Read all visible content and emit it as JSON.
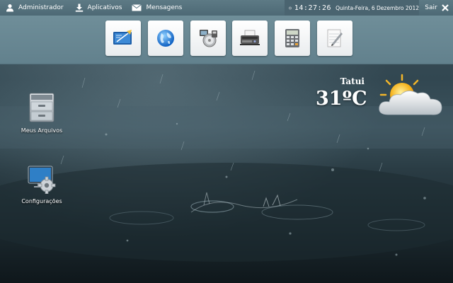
{
  "topbar": {
    "user_label": "Administrador",
    "apps_label": "Aplicativos",
    "messages_label": "Mensagens",
    "clock_time": "14:27:26",
    "clock_date": "Quinta-Feira, 6 Dezembro 2012",
    "exit_label": "Sair"
  },
  "dock": {
    "items": [
      {
        "icon": "text-editor-icon"
      },
      {
        "icon": "globe-browser-icon"
      },
      {
        "icon": "media-player-icon"
      },
      {
        "icon": "fax-printer-icon"
      },
      {
        "icon": "calculator-icon"
      },
      {
        "icon": "notepad-icon"
      }
    ]
  },
  "desktop": {
    "icons": [
      {
        "label": "Meus Arquivos",
        "icon": "file-cabinet-icon"
      },
      {
        "label": "Configurações",
        "icon": "settings-monitor-icon"
      }
    ]
  },
  "weather": {
    "city": "Tatui",
    "temperature": "31ºC",
    "condition_icon": "sun-behind-cloud-icon"
  },
  "colors": {
    "topbar": "#567380",
    "dock": "#6a8994",
    "wallpaper": "#2c3e47"
  }
}
